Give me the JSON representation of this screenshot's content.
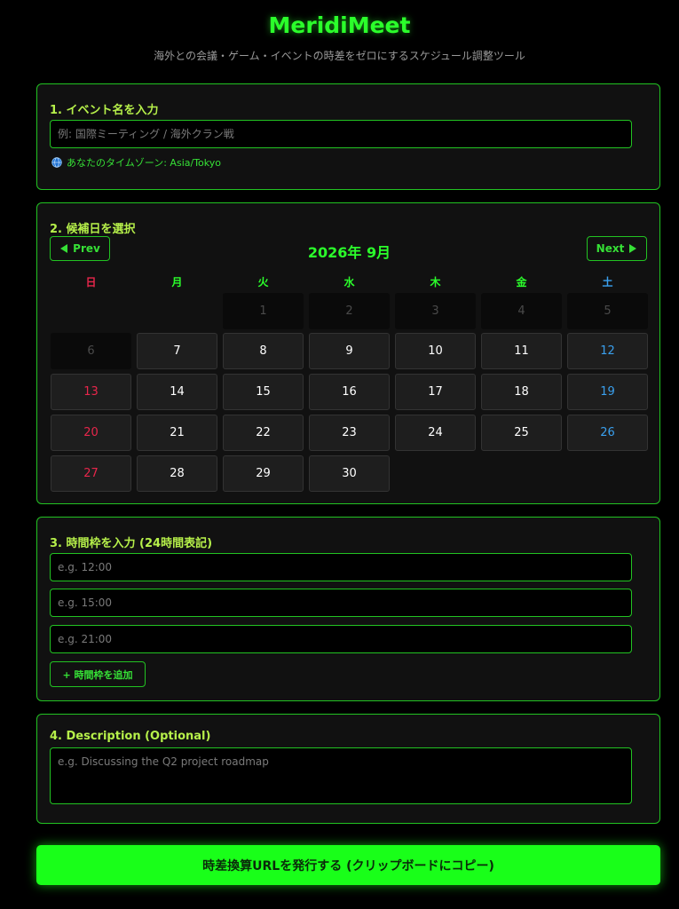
{
  "header": {
    "title": "MeridiMeet",
    "subtitle": "海外との会議・ゲーム・イベントの時差をゼロにするスケジュール調整ツール"
  },
  "event_section": {
    "title": "1. イベント名を入力",
    "input_placeholder": "例: 国際ミーティング / 海外クラン戦",
    "timezone_text": "あなたのタイムゾーン: Asia/Tokyo"
  },
  "date_section": {
    "title": "2. 候補日を選択",
    "prev_label": "Prev",
    "next_label": "Next",
    "month_label": "2026年 9月",
    "weekdays": [
      "日",
      "月",
      "火",
      "水",
      "木",
      "金",
      "土"
    ],
    "weekday_colors": [
      "#e8264b",
      "#2bff2b",
      "#2bff2b",
      "#2bff2b",
      "#2bff2b",
      "#2bff2b",
      "#3aa0ee"
    ],
    "past_days": [
      "1",
      "2",
      "3",
      "4",
      "5",
      "6"
    ],
    "active_days": [
      "7",
      "8",
      "9",
      "10",
      "11",
      "12",
      "13",
      "14",
      "15",
      "16",
      "17",
      "18",
      "19",
      "20",
      "21",
      "22",
      "23",
      "24",
      "25",
      "26",
      "27",
      "28",
      "29",
      "30"
    ]
  },
  "time_section": {
    "title": "3. 時間枠を入力 (24時間表記)",
    "slots": [
      {
        "placeholder": "e.g. 12:00"
      },
      {
        "placeholder": "e.g. 15:00"
      },
      {
        "placeholder": "e.g. 21:00"
      }
    ],
    "add_label": "+ 時間枠を追加"
  },
  "description_section": {
    "title": "4. Description (Optional)",
    "placeholder": "e.g. Discussing the Q2 project roadmap"
  },
  "generate_label": "時差換算URLを発行する (クリップボードにコピー)",
  "colors": {
    "accent_green": "#2bff2b",
    "border_green": "#22c322",
    "sunday_red": "#e8264b",
    "saturday_blue": "#3aa0ee",
    "button_green": "#19ff19"
  }
}
